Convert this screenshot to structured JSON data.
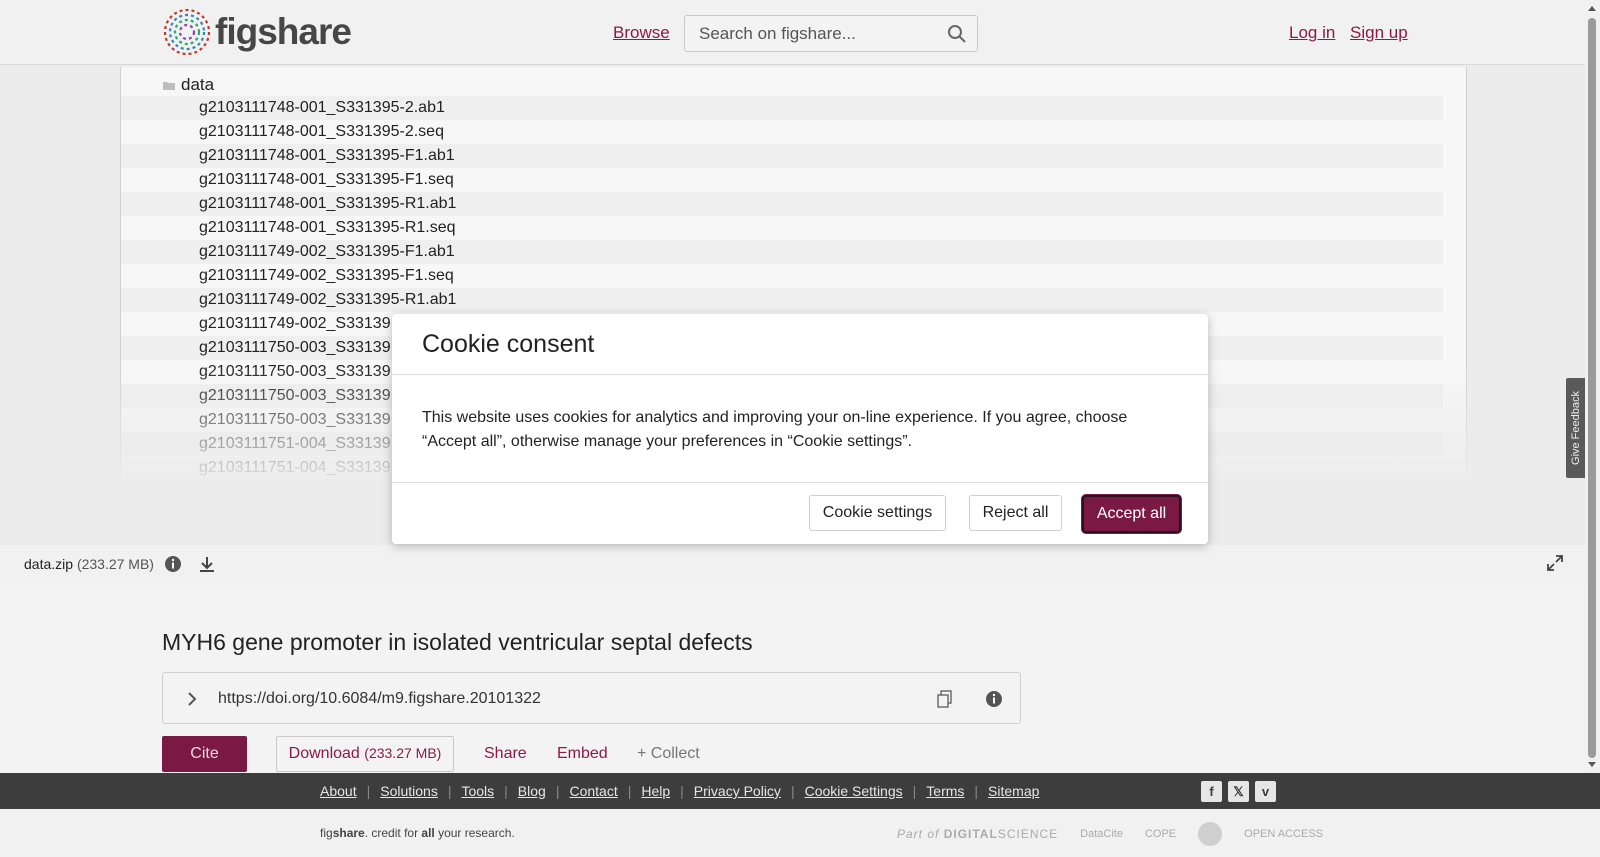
{
  "header": {
    "logo_text": "figshare",
    "browse_label": "Browse",
    "search_placeholder": "Search on figshare...",
    "login_label": "Log in",
    "signup_label": "Sign up"
  },
  "tree": {
    "root_label": "data",
    "files": [
      "g2103111748-001_S331395-2.ab1",
      "g2103111748-001_S331395-2.seq",
      "g2103111748-001_S331395-F1.ab1",
      "g2103111748-001_S331395-F1.seq",
      "g2103111748-001_S331395-R1.ab1",
      "g2103111748-001_S331395-R1.seq",
      "g2103111749-002_S331395-F1.ab1",
      "g2103111749-002_S331395-F1.seq",
      "g2103111749-002_S331395-R1.ab1",
      "g2103111749-002_S33139",
      "g2103111750-003_S33139",
      "g2103111750-003_S33139",
      "g2103111750-003_S33139",
      "g2103111750-003_S33139",
      "g2103111751-004_S33139",
      "g2103111751-004_S33139"
    ]
  },
  "filebar": {
    "filename": "data.zip",
    "filesize": "(233.27 MB)"
  },
  "item": {
    "title": "MYH6 gene promoter in isolated ventricular septal defects",
    "doi": "https://doi.org/10.6084/m9.figshare.20101322",
    "cite_label": "Cite",
    "download_label": "Download",
    "download_size": "(233.27 MB)",
    "share_label": "Share",
    "embed_label": "Embed",
    "collect_label": "+ Collect"
  },
  "feedback_label": "Give Feedback",
  "footer": {
    "links": [
      "About",
      "Solutions",
      "Tools",
      "Blog",
      "Contact",
      "Help",
      "Privacy Policy",
      "Cookie Settings",
      "Terms",
      "Sitemap"
    ],
    "tagline_fig": "fig",
    "tagline_share": "share",
    "tagline_mid": ". credit for ",
    "tagline_all": "all",
    "tagline_end": " your research.",
    "part_of": "Part of",
    "digital": "DIGITAL",
    "science": "SCIENCE",
    "partner_datacite": "DataCite",
    "partner_cope": "COPE",
    "partner_openaccess": "OPEN ACCESS"
  },
  "cookie": {
    "title": "Cookie consent",
    "body": "This website uses cookies for analytics and improving your on-line experience. If you agree, choose “Accept all”, otherwise manage your preferences in “Cookie settings”.",
    "settings_label": "Cookie settings",
    "reject_label": "Reject all",
    "accept_label": "Accept all"
  },
  "colors": {
    "brand": "#7a1a44",
    "link": "#8a1a48",
    "footer_bg": "#3d3d3d"
  }
}
